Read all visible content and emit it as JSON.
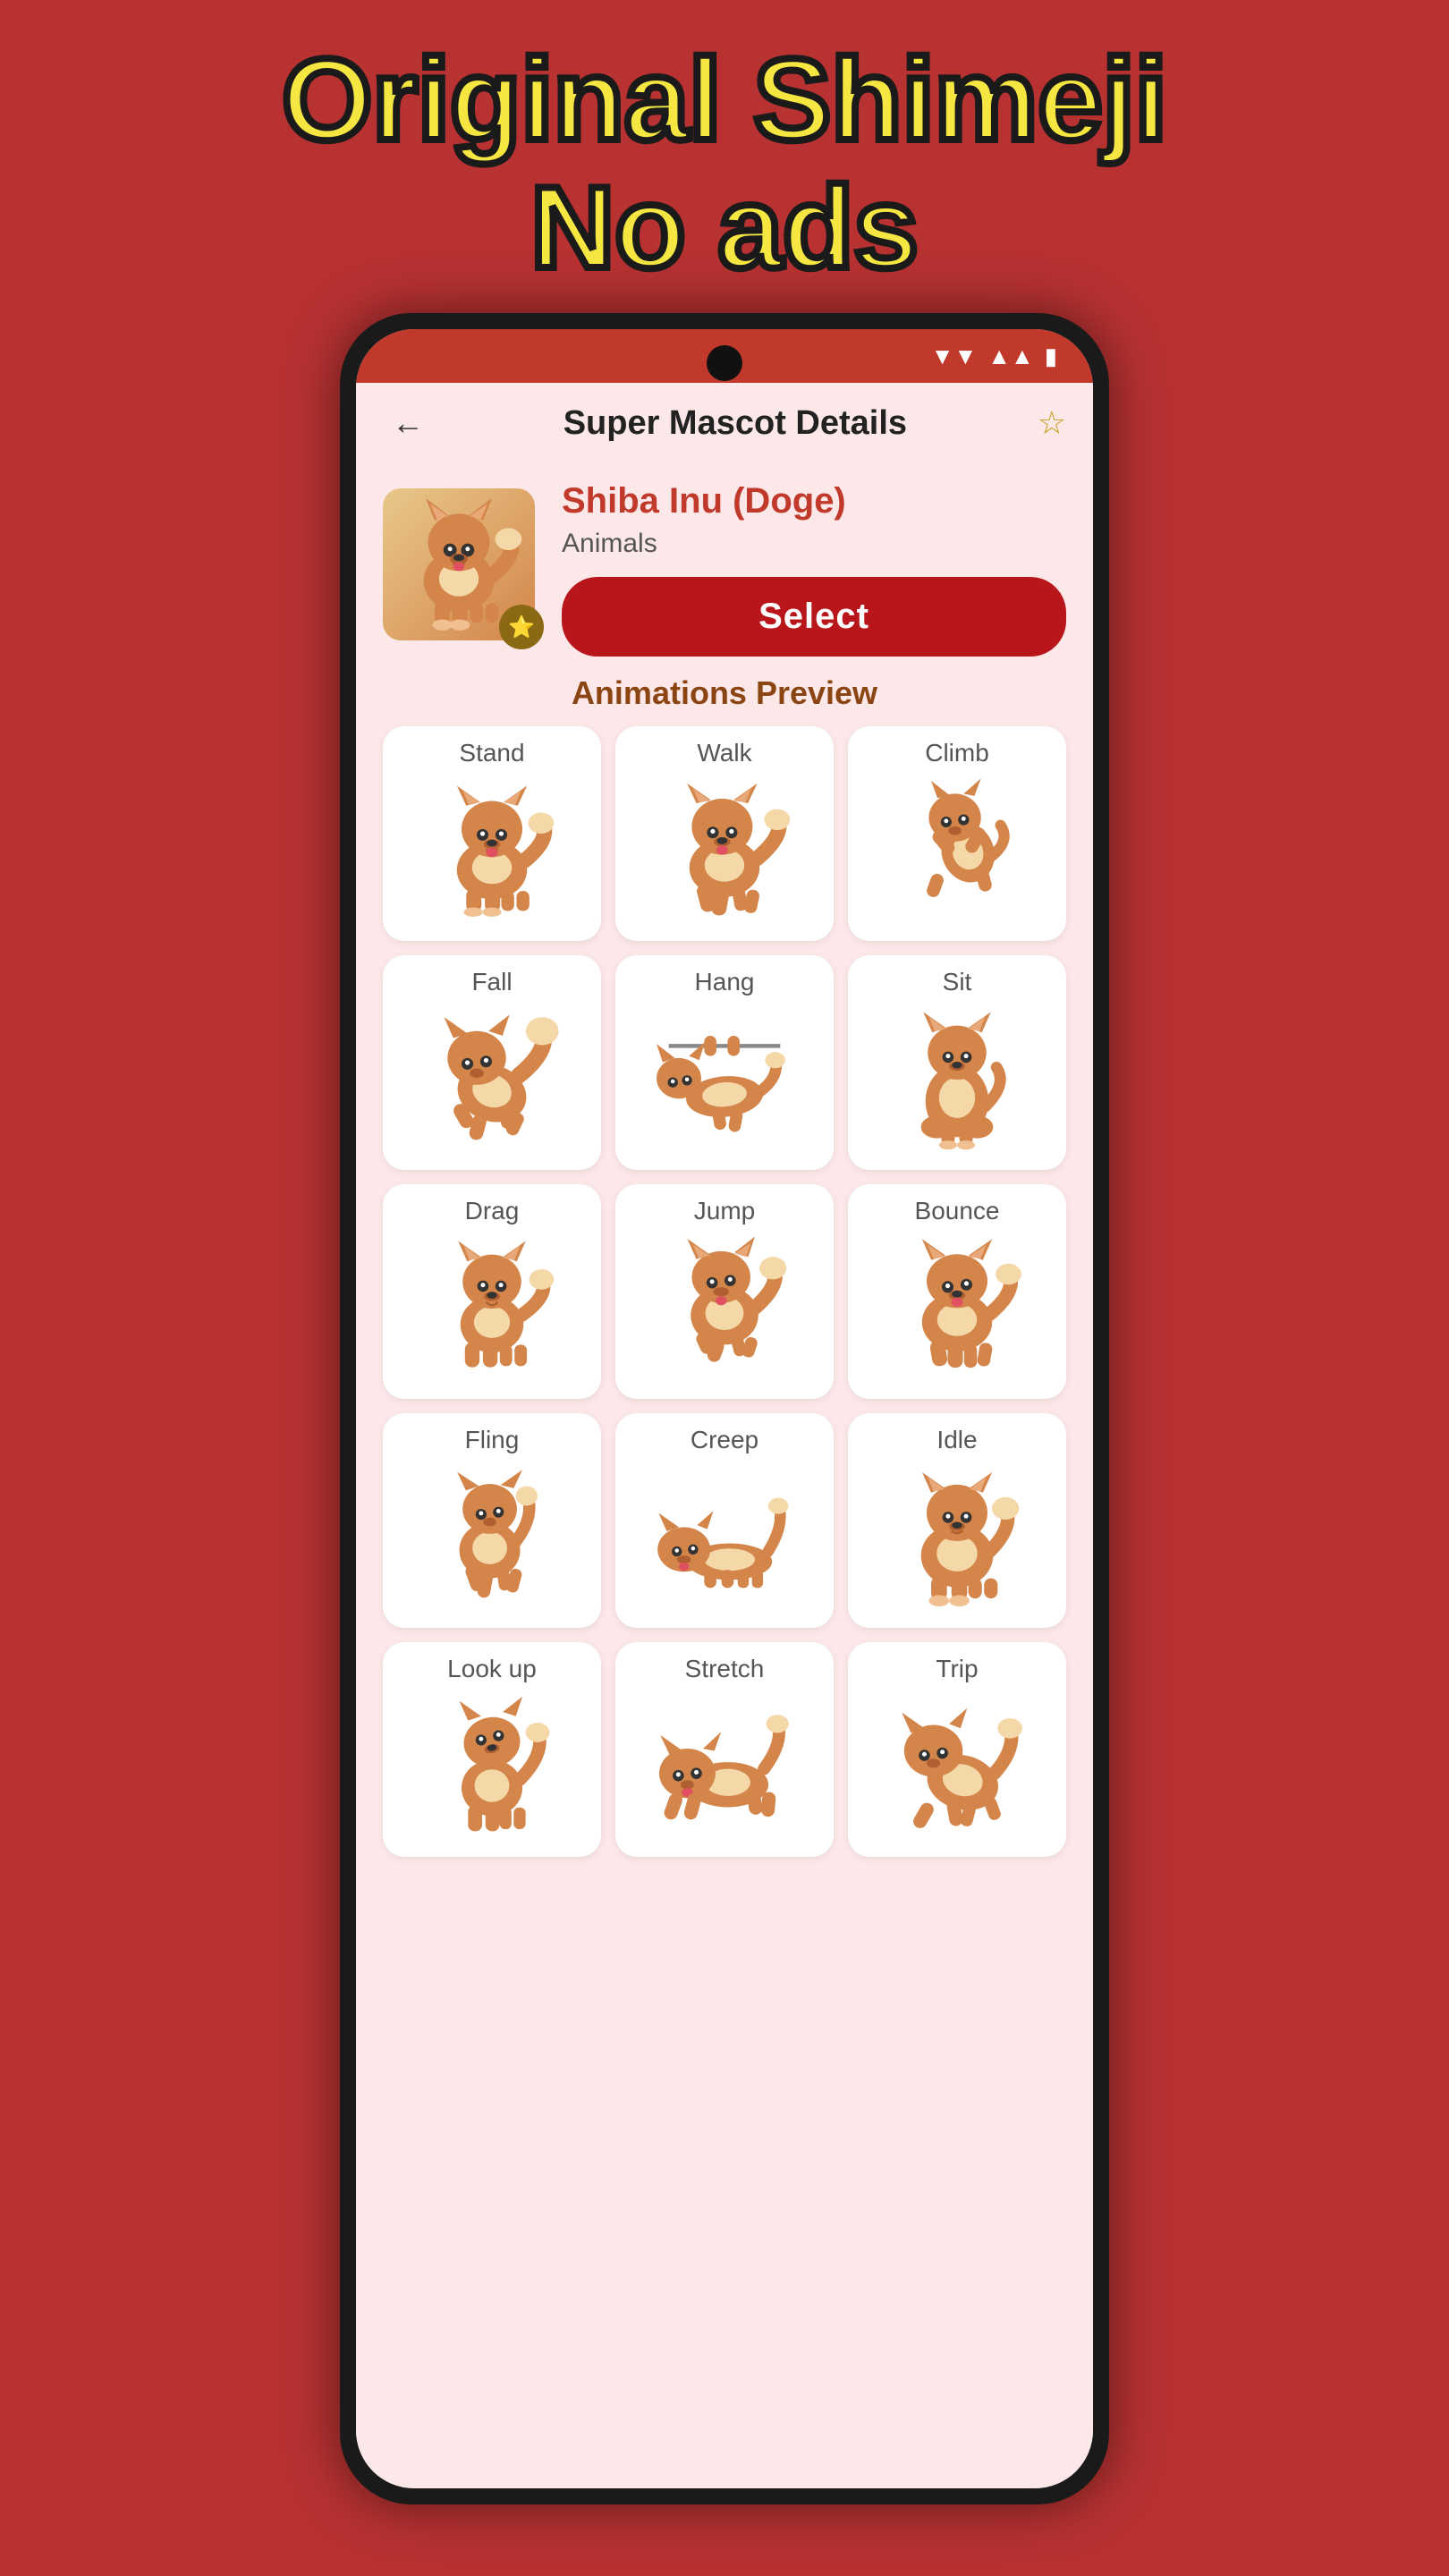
{
  "headline": {
    "line1": "Original Shimeji",
    "line2": "No ads"
  },
  "topBar": {
    "title": "Super Mascot Details",
    "backLabel": "←",
    "starLabel": "☆"
  },
  "mascot": {
    "name": "Shiba Inu (Doge)",
    "category": "Animals",
    "selectLabel": "Select",
    "animationsTitle": "Animations Preview"
  },
  "animations": [
    {
      "label": "Stand"
    },
    {
      "label": "Walk"
    },
    {
      "label": "Climb"
    },
    {
      "label": "Fall"
    },
    {
      "label": "Hang"
    },
    {
      "label": "Sit"
    },
    {
      "label": "Drag"
    },
    {
      "label": "Jump"
    },
    {
      "label": "Bounce"
    },
    {
      "label": "Fling"
    },
    {
      "label": "Creep"
    },
    {
      "label": "Idle"
    },
    {
      "label": "Look up"
    },
    {
      "label": "Stretch"
    },
    {
      "label": "Trip"
    }
  ],
  "colors": {
    "background": "#b83232",
    "headlineColor": "#f5e642",
    "statusBar": "#c0392b",
    "selectBtn": "#b8161a",
    "mascotName": "#c0392b",
    "animTitle": "#8B4513"
  }
}
